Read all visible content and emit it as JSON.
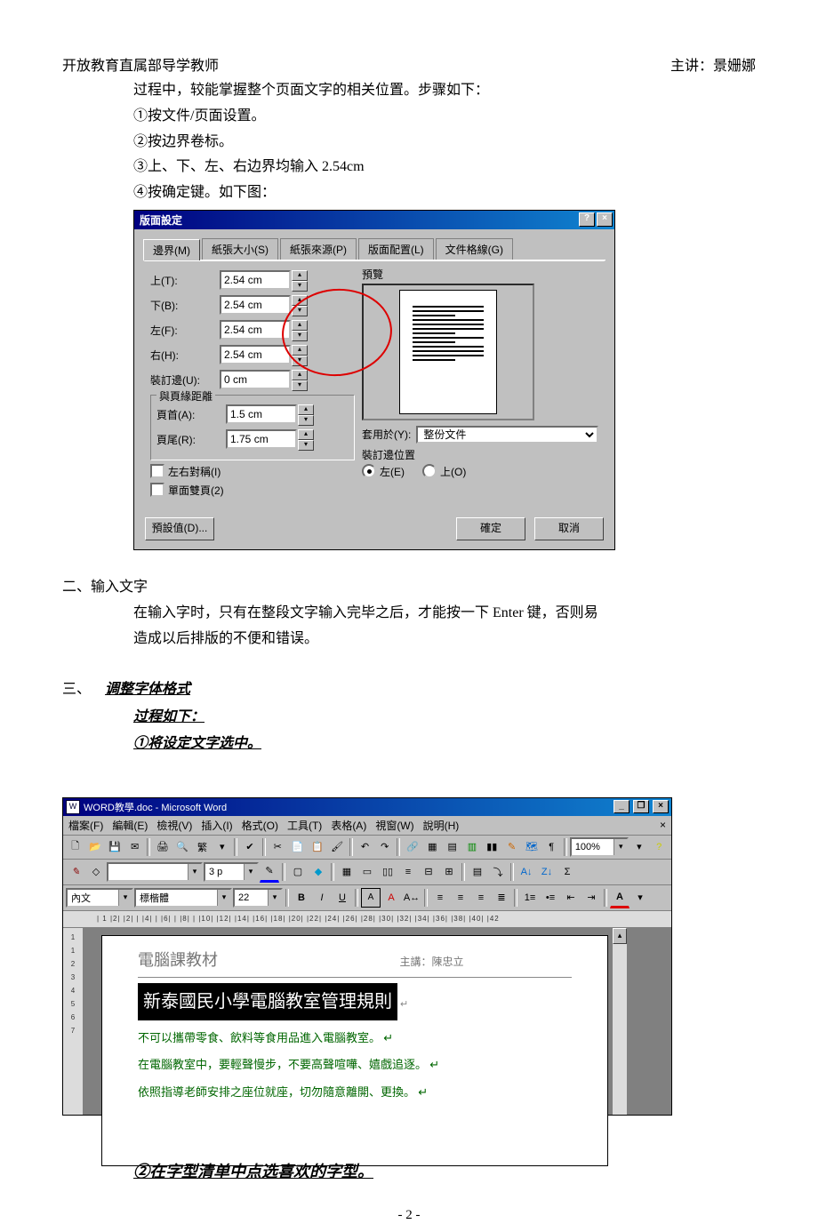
{
  "header": {
    "left": "开放教育直属部导学教师",
    "right": "主讲：景姗娜"
  },
  "intro": {
    "line1": "过程中，较能掌握整个页面文字的相关位置。步骤如下：",
    "step1": "①按文件/页面设置。",
    "step2": "②按边界卷标。",
    "step3": "③上、下、左、右边界均输入 2.54cm",
    "step4": "④按确定键。如下图："
  },
  "dialog": {
    "title": "版面設定",
    "tabs": [
      "邊界(M)",
      "紙張大小(S)",
      "紙張來源(P)",
      "版面配置(L)",
      "文件格線(G)"
    ],
    "margins": {
      "top_label": "上(T):",
      "top": "2.54 cm",
      "bottom_label": "下(B):",
      "bottom": "2.54 cm",
      "left_label": "左(F):",
      "left": "2.54 cm",
      "right_label": "右(H):",
      "right": "2.54 cm",
      "gutter_label": "裝訂邊(U):",
      "gutter": "0 cm"
    },
    "from_edge_group": "與頁緣距離",
    "header_label": "頁首(A):",
    "header_val": "1.5 cm",
    "footer_label": "頁尾(R):",
    "footer_val": "1.75 cm",
    "mirror_label": "左右對稱(I)",
    "twoperpage_label": "單面雙頁(2)",
    "preview_label": "預覽",
    "apply_label": "套用於(Y):",
    "apply_value": "整份文件",
    "gutterpos_label": "裝訂邊位置",
    "gutter_left": "左(E)",
    "gutter_top": "上(O)",
    "default_btn": "預設值(D)...",
    "ok_btn": "確定",
    "cancel_btn": "取消",
    "help_icon": "?",
    "close_icon": "×"
  },
  "section2": {
    "heading": "二、输入文字",
    "p1": "在输入字时，只有在整段文字输入完毕之后，才能按一下 Enter 键，否则易",
    "p2": "造成以后排版的不便和错误。"
  },
  "section3": {
    "heading": "三、",
    "title": "调整字体格式",
    "line1": "过程如下：",
    "line2": "①将设定文字选中。"
  },
  "word": {
    "title": "WORD教學.doc - Microsoft Word",
    "menus": [
      "檔案(F)",
      "編輯(E)",
      "檢視(V)",
      "插入(I)",
      "格式(O)",
      "工具(T)",
      "表格(A)",
      "視窗(W)",
      "說明(H)"
    ],
    "zoom": "100%",
    "style": "內文",
    "font": "標楷體",
    "size": "22",
    "toolbar3_label": "3 p",
    "ruler_marks": "| 1 |2| |2| | |4| | |6| | |8| | |10| |12| |14| |16| |18| |20| |22| |24| |26| |28| |30| |32| |34| |36| |38| |40| |42",
    "vruler": [
      "1",
      "1",
      "2",
      "3",
      "4",
      "5",
      "6",
      "7"
    ],
    "doc": {
      "h1": "電腦課教材",
      "h1_sub": "主講：陳忠立",
      "h2": "新泰國民小學電腦教室管理規則",
      "li1": "不可以攜帶零食、飲料等食用品進入電腦教室。 ↵",
      "li2": "在電腦教室中，要輕聲慢步，不要高聲喧嘩、嬉戲追逐。 ↵",
      "li3": "依照指導老師安排之座位就座，切勿隨意離開、更換。 ↵"
    },
    "min": "_",
    "max": "❐",
    "close": "×"
  },
  "section3b": {
    "line": "②在字型清单中点选喜欢的字型。"
  },
  "page_number": "- 2 -"
}
